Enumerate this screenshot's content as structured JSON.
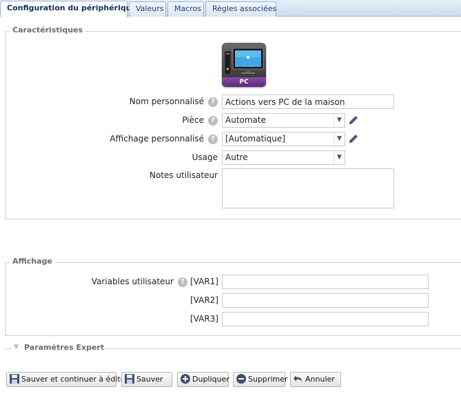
{
  "tabs": [
    {
      "label": "Configuration du périphérique",
      "active": true
    },
    {
      "label": "Valeurs",
      "active": false
    },
    {
      "label": "Macros",
      "active": false
    },
    {
      "label": "Règles associées",
      "active": false
    }
  ],
  "caracteristiques": {
    "legend": "Caractéristiques",
    "device_icon_label": "PC",
    "help_glyph": "?",
    "nom_label": "Nom personnalisé",
    "nom_value": "Actions vers PC de la maison",
    "piece_label": "Pièce",
    "piece_value": "Automate",
    "affichage_label": "Affichage personnalisé",
    "affichage_value": "[Automatique]",
    "usage_label": "Usage",
    "usage_value": "Autre",
    "notes_label": "Notes utilisateur",
    "notes_value": ""
  },
  "affichage": {
    "legend": "Affichage",
    "variables_label": "Variables utilisateur",
    "var1_label": "[VAR1]",
    "var2_label": "[VAR2]",
    "var3_label": "[VAR3]",
    "var1_value": "",
    "var2_value": "",
    "var3_value": ""
  },
  "expert": {
    "label": "Paramètres Expert",
    "arrow": "▼"
  },
  "buttons": {
    "save_continue": "Sauver et continuer à éditer",
    "save": "Sauver",
    "duplicate": "Dupliquer",
    "delete": "Supprimer",
    "cancel": "Annuler"
  },
  "colors": {
    "tab_text": "#1a3f80",
    "legend_text": "#6b6b6b",
    "help_bg": "#b9bec6",
    "pencil": "#4a5f85",
    "device_band": "#6e3590"
  }
}
